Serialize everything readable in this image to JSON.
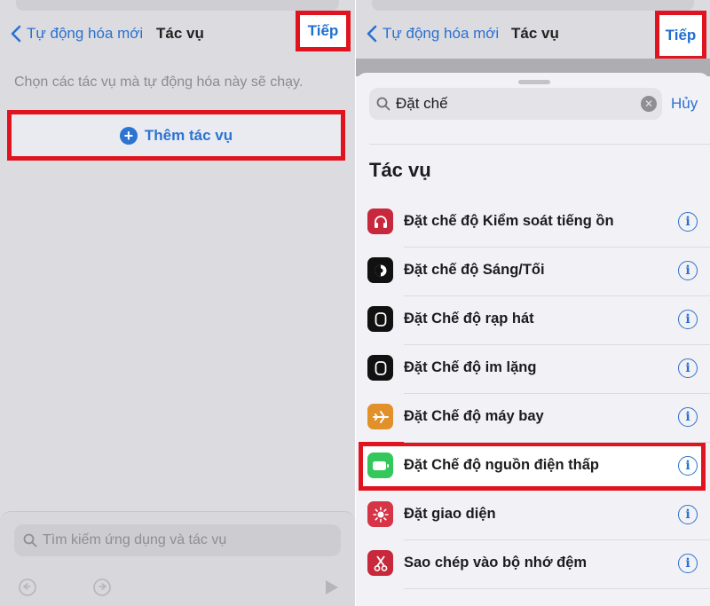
{
  "left_screen": {
    "nav": {
      "back_label": "Tự động hóa mới",
      "title": "Tác vụ",
      "next_label": "Tiếp"
    },
    "hint": "Chọn các tác vụ mà tự động hóa này sẽ chạy.",
    "add_action_label": "Thêm tác vụ",
    "search_placeholder": "Tìm kiếm ứng dụng và tác vụ"
  },
  "right_screen": {
    "nav": {
      "back_label": "Tự động hóa mới",
      "title": "Tác vụ",
      "next_label": "Tiếp"
    },
    "search": {
      "value": "Đặt chế",
      "cancel_label": "Hủy"
    },
    "section_title": "Tác vụ",
    "actions": [
      {
        "label": "Đặt chế độ Kiểm soát tiếng ồn",
        "icon": "headphones-icon",
        "color": "#c8283c"
      },
      {
        "label": "Đặt chế độ Sáng/Tối",
        "icon": "appearance-icon",
        "color": "#111111"
      },
      {
        "label": "Đặt Chế độ rạp hát",
        "icon": "watch-icon",
        "color": "#111111"
      },
      {
        "label": "Đặt Chế độ im lặng",
        "icon": "watch-icon",
        "color": "#111111"
      },
      {
        "label": "Đặt Chế độ máy bay",
        "icon": "airplane-icon",
        "color": "#e2902a"
      },
      {
        "label": "Đặt Chế độ nguồn điện thấp",
        "icon": "battery-icon",
        "color": "#34c759"
      },
      {
        "label": "Đặt giao diện",
        "icon": "brightness-icon",
        "color": "#d63447"
      },
      {
        "label": "Sao chép vào bộ nhớ đệm",
        "icon": "scissors-icon",
        "color": "#c8283c"
      }
    ]
  },
  "colors": {
    "accent": "#2b70cf",
    "highlight": "#e0141e"
  }
}
